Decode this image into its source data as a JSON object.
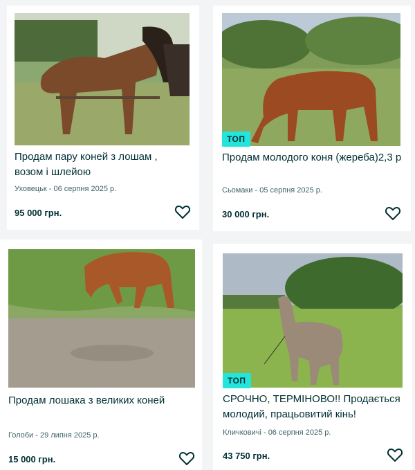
{
  "listings": [
    {
      "title": "Продам пару коней з лошам , возом і шлейою",
      "location_date": "Уховецьк - 06 серпня 2025 р.",
      "price": "95 000 грн.",
      "badge": ""
    },
    {
      "title": "Продам молодого коня (жереба)2,3 р",
      "location_date": "Сьомаки - 05 серпня 2025 р.",
      "price": "30 000 грн.",
      "badge": "ТОП"
    },
    {
      "title": "Продам лошака з великих коней",
      "location_date": "Голоби - 29 липня 2025 р.",
      "price": "15 000 грн.",
      "badge": ""
    },
    {
      "title": "СРОЧНО, ТЕРМІНОВО!! Продається молодий, працьовитий кінь!",
      "location_date": "Кличковичі - 06 серпня 2025 р.",
      "price": "43 750 грн.",
      "badge": "ТОП"
    }
  ],
  "icons": {
    "favorite": "heart-outline-icon"
  },
  "colors": {
    "badge_bg": "#23e5db",
    "text": "#002f34",
    "meta": "#406367"
  }
}
